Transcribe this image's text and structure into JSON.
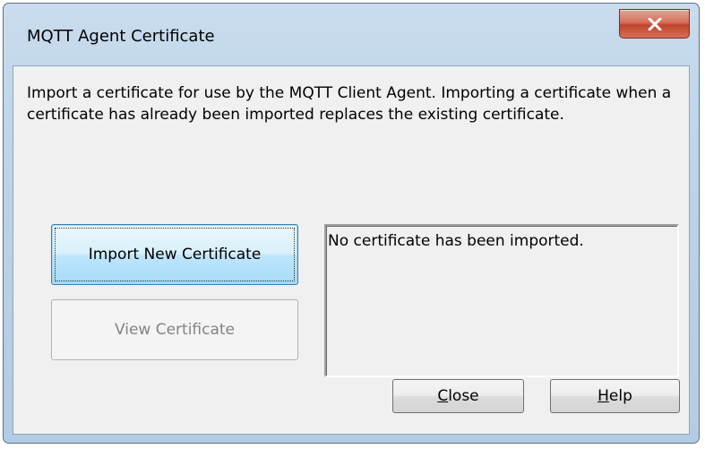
{
  "window": {
    "title": "MQTT Agent Certificate",
    "close_icon": "close-x-icon",
    "colors": {
      "frame": "#bcd3e9",
      "close_button": "#c9452e",
      "dialog_background": "#f0f0f0"
    }
  },
  "description": "Import a certificate for use by the MQTT Client Agent. Importing a certificate when a certificate has already been imported replaces the existing certificate.",
  "buttons": {
    "import_label": "Import New Certificate",
    "view_label": "View Certificate",
    "close": {
      "mnemonic": "C",
      "rest": "lose"
    },
    "help": {
      "mnemonic": "H",
      "rest": "elp"
    }
  },
  "status": {
    "text": "No certificate has been imported."
  }
}
